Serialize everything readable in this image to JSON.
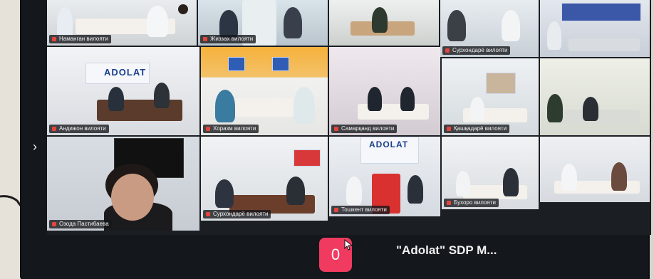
{
  "tiles": [
    {
      "id": "t1",
      "label": "Наманган вилояти"
    },
    {
      "id": "t2",
      "label": "Жиззах вилояти"
    },
    {
      "id": "t3",
      "label": ""
    },
    {
      "id": "t4",
      "label": "Сурхондарё вилояти"
    },
    {
      "id": "t5",
      "label": ""
    },
    {
      "id": "t6",
      "label": "Андижон вилояти"
    },
    {
      "id": "t7",
      "label": "Хоразм вилояти"
    },
    {
      "id": "t8",
      "label": "Самарқанд вилояти"
    },
    {
      "id": "t9",
      "label": "Қашқадарё вилояти"
    },
    {
      "id": "t10",
      "label": ""
    },
    {
      "id": "t11",
      "label": "Озода Пастибаева"
    },
    {
      "id": "t12",
      "label": "Сурхондарё вилояти"
    },
    {
      "id": "t13",
      "label": "Тошкент вилояти"
    },
    {
      "id": "t14",
      "label": "Бухоро вилояти"
    },
    {
      "id": "t15",
      "label": ""
    }
  ],
  "banners": {
    "adolat": "ADOLAT",
    "adolat_small": "ADOLAT"
  },
  "meeting": {
    "participant_count": "0",
    "title": "\"Adolat\" SDP M..."
  },
  "colors": {
    "accent": "#f03a5f",
    "party_blue": "#1b3f8f"
  }
}
